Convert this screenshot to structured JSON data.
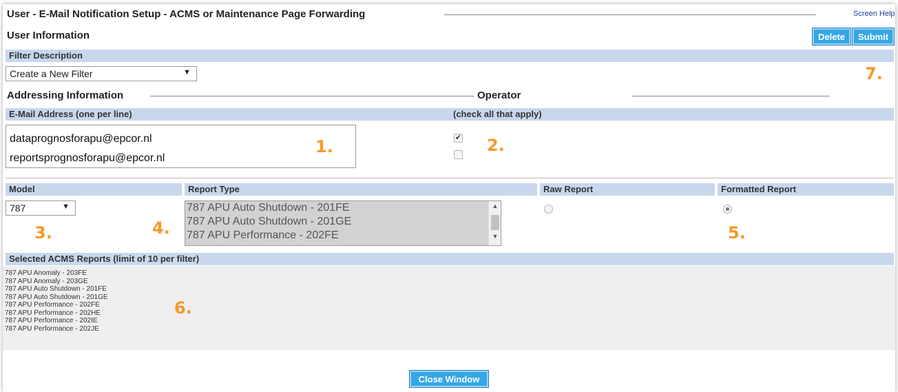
{
  "page": {
    "title": "User - E-Mail Notification Setup - ACMS or Maintenance Page Forwarding",
    "help_link": "Screen Help"
  },
  "user_info": {
    "heading": "User Information",
    "delete_label": "Delete",
    "submit_label": "Submit"
  },
  "filter": {
    "header": "Filter Description",
    "selected": "Create a New Filter"
  },
  "addressing": {
    "heading": "Addressing Information",
    "operator_heading": "Operator",
    "email_header": "E-Mail Address (one per line)",
    "emails": [
      "dataprognosforapu@epcor.nl",
      "reportsprognosforapu@epcor.nl"
    ],
    "operator_header": "(check all that apply)",
    "operator_checks": [
      true,
      false
    ]
  },
  "model": {
    "header": "Model",
    "selected": "787"
  },
  "report_type": {
    "header": "Report Type",
    "options": [
      "787 APU Auto Shutdown - 201FE",
      "787 APU Auto Shutdown - 201GE",
      "787 APU Performance - 202FE"
    ]
  },
  "format": {
    "raw_header": "Raw Report",
    "formatted_header": "Formatted Report",
    "raw_selected": false,
    "formatted_selected": true
  },
  "selected_reports": {
    "header": "Selected ACMS Reports (limit of 10 per filter)",
    "items": [
      "787 APU Anomaly - 203FE",
      "787 APU Anomaly - 203GE",
      "787 APU Auto Shutdown - 201FE",
      "787 APU Auto Shutdown - 201GE",
      "787 APU Performance - 202FE",
      "787 APU Performance - 202HE",
      "787 APU Performance - 202IE",
      "787 APU Performance - 202JE"
    ]
  },
  "close_label": "Close Window",
  "markers": {
    "m1": "1.",
    "m2": "2.",
    "m3": "3.",
    "m4": "4.",
    "m5": "5.",
    "m6": "6.",
    "m7": "7."
  },
  "colors": {
    "section_bar": "#c8d7ec",
    "button": "#35a7e6",
    "marker": "#f49a2a"
  },
  "icons": {
    "dropdown": "chevron-down-icon",
    "checkbox": "checkbox-icon",
    "radio": "radio-button-icon"
  }
}
